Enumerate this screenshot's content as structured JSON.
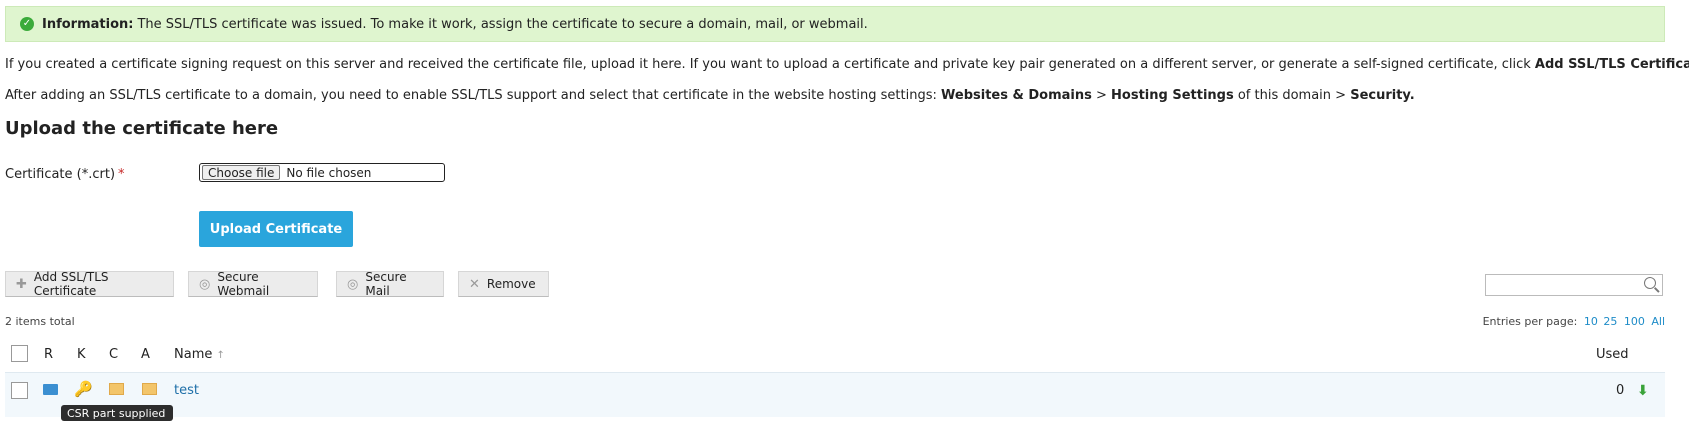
{
  "banner": {
    "title": "Information:",
    "text": "The SSL/TLS certificate was issued. To make it work, assign the certificate to secure a domain, mail, or webmail."
  },
  "intro": {
    "text1": "If you created a certificate signing request on this server and received the certificate file, upload it here. If you want to upload a certificate and private key pair generated on a different server, or generate a self-signed certificate, click ",
    "bold1": "Add SSL/TLS Certificate.",
    "text2": "After adding an SSL/TLS certificate to a domain, you need to enable SSL/TLS support and select that certificate in the website hosting settings: ",
    "bold2a": "Websites & Domains",
    "sep1": " > ",
    "bold2b": "Hosting Settings",
    "mid": " of this domain > ",
    "bold2c": "Security."
  },
  "upload": {
    "heading": "Upload the certificate here",
    "label": "Certificate (*.crt)",
    "required": "*",
    "choose_label": "Choose file",
    "file_status": "No file chosen",
    "button_label": "Upload Certificate"
  },
  "toolbar": {
    "add_label": "Add SSL/TLS Certificate",
    "webmail_label": "Secure Webmail",
    "mail_label": "Secure Mail",
    "remove_label": "Remove"
  },
  "list": {
    "total": "2 items total",
    "entries_label": "Entries per page:",
    "entries_options": [
      "10",
      "25",
      "100",
      "All"
    ],
    "columns": {
      "r": "R",
      "k": "K",
      "c": "C",
      "a": "A",
      "name": "Name",
      "sort_indicator": "↑",
      "used": "Used"
    },
    "rows": [
      {
        "name": "test",
        "used": "0"
      }
    ]
  },
  "tooltip": "CSR part supplied",
  "colors": {
    "accent": "#2aa5dc",
    "banner_bg": "#dff5cf",
    "link": "#1e6fa8"
  }
}
